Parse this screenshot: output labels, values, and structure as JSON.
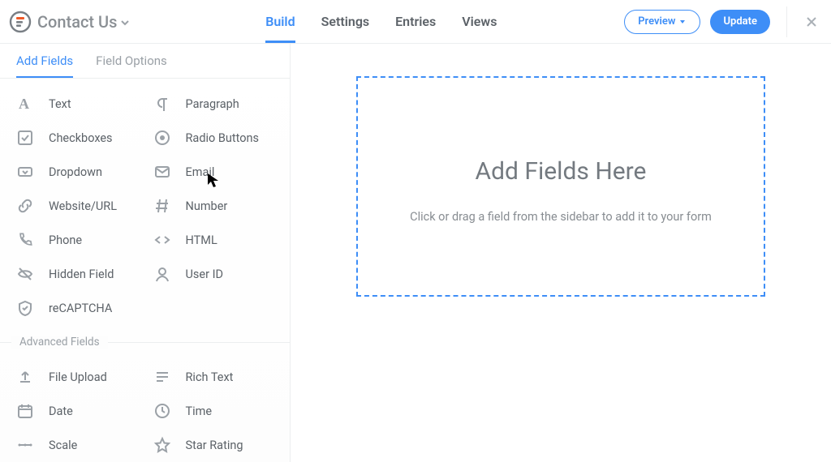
{
  "header": {
    "form_title": "Contact Us",
    "nav": {
      "build": "Build",
      "settings": "Settings",
      "entries": "Entries",
      "views": "Views"
    },
    "preview_label": "Preview",
    "update_label": "Update"
  },
  "sidebar": {
    "tabs": {
      "add_fields": "Add Fields",
      "field_options": "Field Options"
    },
    "basic_fields": [
      {
        "icon": "text-a-icon",
        "label": "Text"
      },
      {
        "icon": "paragraph-icon",
        "label": "Paragraph"
      },
      {
        "icon": "checkbox-icon",
        "label": "Checkboxes"
      },
      {
        "icon": "radio-icon",
        "label": "Radio Buttons"
      },
      {
        "icon": "dropdown-icon",
        "label": "Dropdown"
      },
      {
        "icon": "email-icon",
        "label": "Email"
      },
      {
        "icon": "link-icon",
        "label": "Website/URL"
      },
      {
        "icon": "hash-icon",
        "label": "Number"
      },
      {
        "icon": "phone-icon",
        "label": "Phone"
      },
      {
        "icon": "code-icon",
        "label": "HTML"
      },
      {
        "icon": "hidden-icon",
        "label": "Hidden Field"
      },
      {
        "icon": "user-icon",
        "label": "User ID"
      },
      {
        "icon": "shield-icon",
        "label": "reCAPTCHA"
      }
    ],
    "advanced_heading": "Advanced Fields",
    "advanced_fields": [
      {
        "icon": "upload-icon",
        "label": "File Upload"
      },
      {
        "icon": "richtext-icon",
        "label": "Rich Text"
      },
      {
        "icon": "calendar-icon",
        "label": "Date"
      },
      {
        "icon": "clock-icon",
        "label": "Time"
      },
      {
        "icon": "scale-icon",
        "label": "Scale"
      },
      {
        "icon": "star-icon",
        "label": "Star Rating"
      }
    ]
  },
  "canvas": {
    "title": "Add Fields Here",
    "subtitle": "Click or drag a field from the sidebar to add it to your form"
  },
  "colors": {
    "accent": "#3e8ef7"
  }
}
